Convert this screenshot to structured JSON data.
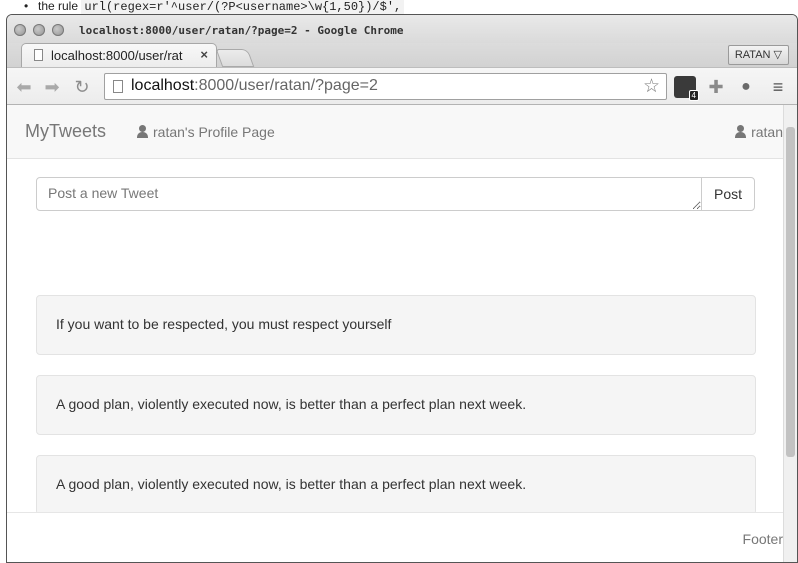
{
  "doc": {
    "bullet": "•",
    "prefix": "the rule",
    "code": "url(regex=r'^user/(?P<username>\\w{1,50})/$',"
  },
  "window": {
    "title": "localhost:8000/user/ratan/?page=2 - Google Chrome"
  },
  "tabs": [
    {
      "label": "localhost:8000/user/rat",
      "close": "×"
    }
  ],
  "profile_button": "RATAN ▽",
  "address_bar": {
    "host": "localhost",
    "rest": ":8000/user/ratan/?page=2"
  },
  "extensions": {
    "badge": "4"
  },
  "app": {
    "brand": "MyTweets",
    "profile_link": "ratan's Profile Page",
    "user_link": "ratan",
    "tweet_placeholder": "Post a new Tweet",
    "post_label": "Post",
    "tweets": [
      "If you want to be respected, you must respect yourself",
      "A good plan, violently executed now, is better than a perfect plan next week.",
      "A good plan, violently executed now, is better than a perfect plan next week."
    ],
    "footer": "Footer"
  }
}
